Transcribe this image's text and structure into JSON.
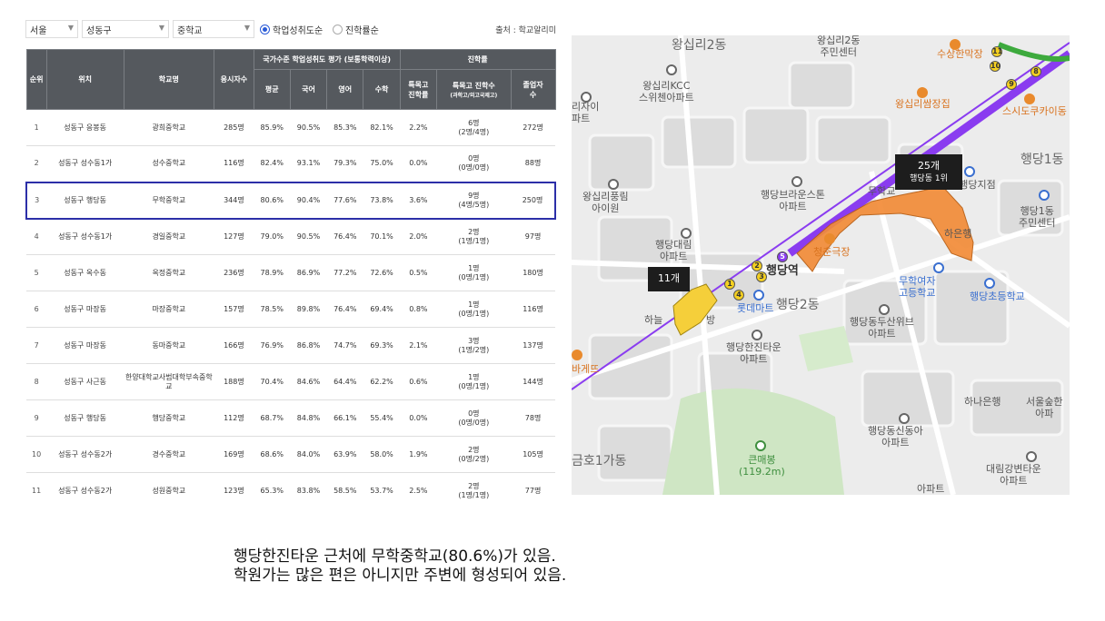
{
  "filters": {
    "region": "서울",
    "district": "성동구",
    "level": "중학교",
    "sort_options": [
      {
        "label": "학업성취도순",
        "selected": true
      },
      {
        "label": "진학률순",
        "selected": false
      }
    ],
    "source": "출처 : 학교알리미"
  },
  "table": {
    "headers": {
      "rank": "순위",
      "location": "위치",
      "school": "학교명",
      "examinees": "응시자수",
      "national_group": "국가수준 학업성취도 평가 (보통학력이상)",
      "avg": "평균",
      "korean": "국어",
      "english": "영어",
      "math": "수학",
      "advance_group": "진학률",
      "special_rate": "특목고\n진학률",
      "special_count": "특목고 진학수",
      "special_count_sub": "(과학고/외고국제고)",
      "graduates": "졸업자\n수"
    },
    "rows": [
      {
        "rank": "1",
        "location": "성동구 응봉동",
        "school": "광희중학교",
        "examinees": "285명",
        "avg": "85.9%",
        "korean": "90.5%",
        "english": "85.3%",
        "math": "82.1%",
        "special_rate": "2.2%",
        "special_count": "6명",
        "special_detail": "(2명/4명)",
        "graduates": "272명",
        "highlight": false
      },
      {
        "rank": "2",
        "location": "성동구 성수동1가",
        "school": "성수중학교",
        "examinees": "116명",
        "avg": "82.4%",
        "korean": "93.1%",
        "english": "79.3%",
        "math": "75.0%",
        "special_rate": "0.0%",
        "special_count": "0명",
        "special_detail": "(0명/0명)",
        "graduates": "88명",
        "highlight": false
      },
      {
        "rank": "3",
        "location": "성동구 행당동",
        "school": "무학중학교",
        "examinees": "344명",
        "avg": "80.6%",
        "korean": "90.4%",
        "english": "77.6%",
        "math": "73.8%",
        "special_rate": "3.6%",
        "special_count": "9명",
        "special_detail": "(4명/5명)",
        "graduates": "250명",
        "highlight": true
      },
      {
        "rank": "4",
        "location": "성동구 성수동1가",
        "school": "경일중학교",
        "examinees": "127명",
        "avg": "79.0%",
        "korean": "90.5%",
        "english": "76.4%",
        "math": "70.1%",
        "special_rate": "2.0%",
        "special_count": "2명",
        "special_detail": "(1명/1명)",
        "graduates": "97명",
        "highlight": false
      },
      {
        "rank": "5",
        "location": "성동구 옥수동",
        "school": "옥정중학교",
        "examinees": "236명",
        "avg": "78.9%",
        "korean": "86.9%",
        "english": "77.2%",
        "math": "72.6%",
        "special_rate": "0.5%",
        "special_count": "1명",
        "special_detail": "(0명/1명)",
        "graduates": "180명",
        "highlight": false
      },
      {
        "rank": "6",
        "location": "성동구 마장동",
        "school": "마장중학교",
        "examinees": "157명",
        "avg": "78.5%",
        "korean": "89.8%",
        "english": "76.4%",
        "math": "69.4%",
        "special_rate": "0.8%",
        "special_count": "1명",
        "special_detail": "(0명/1명)",
        "graduates": "116명",
        "highlight": false
      },
      {
        "rank": "7",
        "location": "성동구 마장동",
        "school": "동마중학교",
        "examinees": "166명",
        "avg": "76.9%",
        "korean": "86.8%",
        "english": "74.7%",
        "math": "69.3%",
        "special_rate": "2.1%",
        "special_count": "3명",
        "special_detail": "(1명/2명)",
        "graduates": "137명",
        "highlight": false
      },
      {
        "rank": "8",
        "location": "성동구 사근동",
        "school": "한양대학교사범대학부속중학교",
        "examinees": "188명",
        "avg": "70.4%",
        "korean": "84.6%",
        "english": "64.4%",
        "math": "62.2%",
        "special_rate": "0.6%",
        "special_count": "1명",
        "special_detail": "(0명/1명)",
        "graduates": "144명",
        "highlight": false
      },
      {
        "rank": "9",
        "location": "성동구 행당동",
        "school": "행당중학교",
        "examinees": "112명",
        "avg": "68.7%",
        "korean": "84.8%",
        "english": "66.1%",
        "math": "55.4%",
        "special_rate": "0.0%",
        "special_count": "0명",
        "special_detail": "(0명/0명)",
        "graduates": "78명",
        "highlight": false
      },
      {
        "rank": "10",
        "location": "성동구 성수동2가",
        "school": "경수중학교",
        "examinees": "169명",
        "avg": "68.6%",
        "korean": "84.0%",
        "english": "63.9%",
        "math": "58.0%",
        "special_rate": "1.9%",
        "special_count": "2명",
        "special_detail": "(0명/2명)",
        "graduates": "105명",
        "highlight": false
      },
      {
        "rank": "11",
        "location": "성동구 성수동2가",
        "school": "성원중학교",
        "examinees": "123명",
        "avg": "65.3%",
        "korean": "83.8%",
        "english": "58.5%",
        "math": "53.7%",
        "special_rate": "2.5%",
        "special_count": "2명",
        "special_detail": "(1명/1명)",
        "graduates": "77명",
        "highlight": false
      }
    ]
  },
  "map": {
    "labels": {
      "wangsimni2": "왕십리2동",
      "wangsimni2_center": "왕십리2동\n주민센터",
      "suyu_hanmakjang": "수상한막장",
      "wangsimni_kcc": "왕십리KCC\n스위첸아파트",
      "wangsimni_ssamjip": "왕십리쌈장집",
      "sushi_kaimodong": "스시도쿠카이동",
      "rijai_apt": "리자이\n파트",
      "haengdang1": "행당1동",
      "wangsimni_pungrim": "왕십리풍림\n아이원",
      "haengdang_brownstone": "행당브라운스톤\n아파트",
      "muhak_school": "무학교",
      "kt_branch": "T 행당지점",
      "haengdang1_center": "행당1동\n주민센터",
      "hana_bank_top": "하은행",
      "haengdang_daerim": "행당대림\n아파트",
      "cheongchun": "청춘극장",
      "haengdang_station": "행당역",
      "muhak_girls": "무학여자\n고등학교",
      "haengdang_elem": "행당초등학교",
      "lotte_mart": "롯데마트",
      "haengdang2": "행당2동",
      "haneul_room": "하늘",
      "haneul_room2": "방",
      "dusan_we": "행당동두산위브\n아파트",
      "hanjin_town": "행당한진타운\n아파트",
      "bagetteu": "바게뜨",
      "hana_bank": "하나은행",
      "seoul_forest": "서울숲한\n아파",
      "haengdang_shina": "행당동신동아\n아파트",
      "kunmaebong": "큰매봉\n(119.2m)",
      "geumho1": "금호1가동",
      "daerim_gangbyeon": "대림강변타운\n아파트",
      "apt_bottom": "아파트"
    },
    "tag_25": {
      "count": "25개",
      "rank": "행당동 1위"
    },
    "tag_11": {
      "count": "11개"
    },
    "stations": {
      "s1": "1",
      "s2": "2",
      "s3": "3",
      "s4": "4",
      "s5": "5",
      "s8": "8",
      "s9": "9",
      "s10": "10",
      "s11": "11"
    },
    "colors": {
      "line5": "#8a3cf0",
      "zone_high": "#f28c38",
      "zone_low": "#f5cf3a",
      "green": "#3daa3d"
    }
  },
  "caption": {
    "line1": "행당한진타운 근처에 무학중학교(80.6%)가 있음.",
    "line2": "학원가는 많은 편은 아니지만 주변에 형성되어 있음."
  }
}
